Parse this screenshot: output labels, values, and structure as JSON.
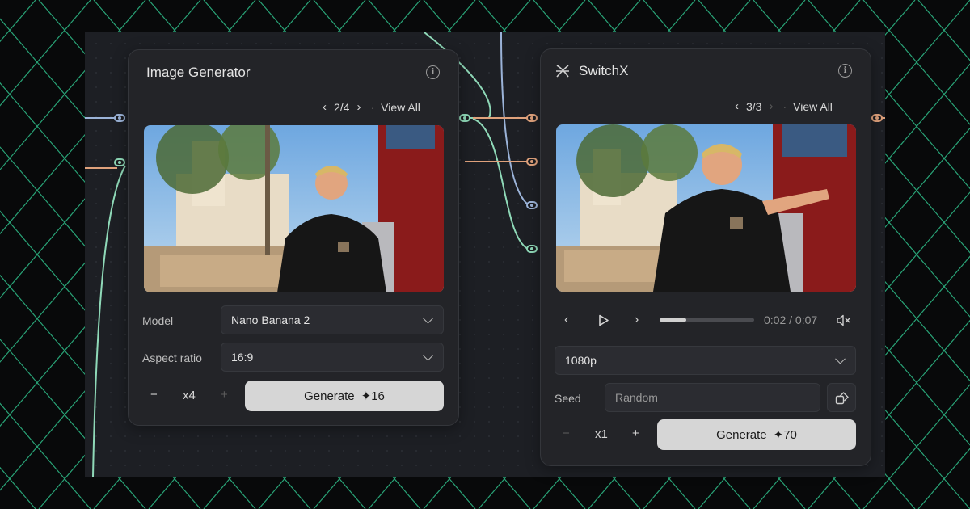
{
  "left_panel": {
    "title": "Image Generator",
    "info_icon": "info-icon",
    "nav": {
      "prev": "‹",
      "count": "2/4",
      "next": "›",
      "view_all": "View All"
    },
    "model_label": "Model",
    "model_value": "Nano Banana 2",
    "aspect_label": "Aspect ratio",
    "aspect_value": "16:9",
    "stepper": {
      "minus": "−",
      "value": "x4",
      "plus": "+"
    },
    "generate": {
      "label": "Generate",
      "cost": "✦16"
    }
  },
  "right_panel": {
    "title": "SwitchX",
    "logo_icon": "switchx-logo-icon",
    "info_icon": "info-icon",
    "nav": {
      "prev": "‹",
      "count": "3/3",
      "next": "›",
      "view_all": "View All"
    },
    "player": {
      "time": "0:02 / 0:07",
      "progress": 0.28,
      "muted": true
    },
    "resolution": "1080p",
    "seed_label": "Seed",
    "seed_placeholder": "Random",
    "stepper": {
      "minus": "−",
      "value": "x1",
      "plus": "+"
    },
    "generate": {
      "label": "Generate",
      "cost": "✦70"
    }
  },
  "colors": {
    "background": "#08090a",
    "canvas": "#1d1f24",
    "panel": "#232428",
    "grid_lines": "#2fbf8a",
    "wire_blue": "#9bb3d8",
    "wire_green": "#8fd9b8",
    "wire_orange": "#e0a27c"
  }
}
